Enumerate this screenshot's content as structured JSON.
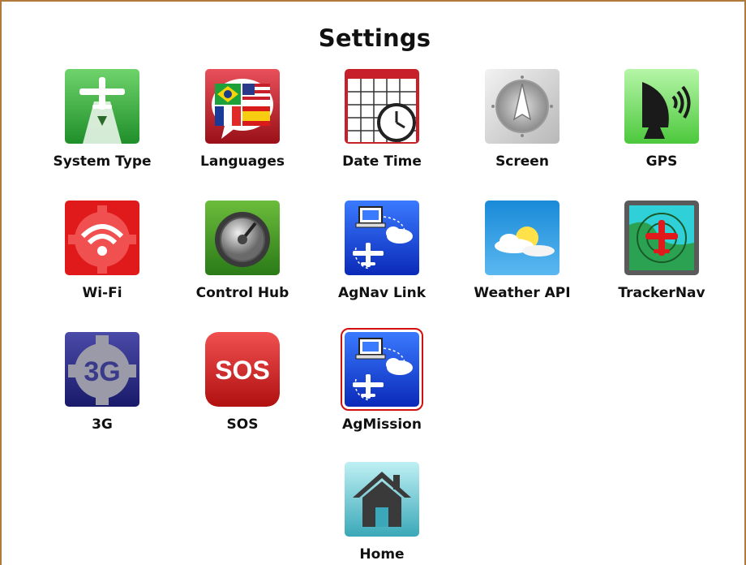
{
  "page": {
    "title": "Settings"
  },
  "tiles": [
    {
      "label": "System Type",
      "icon": "aircraft-runway-icon",
      "selected": false
    },
    {
      "label": "Languages",
      "icon": "language-flags-icon",
      "selected": false
    },
    {
      "label": "Date Time",
      "icon": "calendar-clock-icon",
      "selected": false
    },
    {
      "label": "Screen",
      "icon": "screen-compass-icon",
      "selected": false
    },
    {
      "label": "GPS",
      "icon": "gps-satellite-dish-icon",
      "selected": false
    },
    {
      "label": "Wi-Fi",
      "icon": "wifi-gear-icon",
      "selected": false
    },
    {
      "label": "Control Hub",
      "icon": "control-knob-icon",
      "selected": false
    },
    {
      "label": "AgNav Link",
      "icon": "laptop-airplane-cloud-icon",
      "selected": false
    },
    {
      "label": "Weather API",
      "icon": "weather-sun-cloud-icon",
      "selected": false
    },
    {
      "label": "TrackerNav",
      "icon": "tracker-radar-plane-icon",
      "selected": false
    },
    {
      "label": "3G",
      "icon": "3g-gear-icon",
      "icon_text": "3G",
      "selected": false
    },
    {
      "label": "SOS",
      "icon": "sos-icon",
      "icon_text": "SOS",
      "selected": false
    },
    {
      "label": "AgMission",
      "icon": "laptop-airplane-cloud-icon",
      "selected": true
    },
    {
      "label": "Home",
      "icon": "home-icon",
      "selected": false
    }
  ],
  "colors": {
    "frame_border": "#b07a3c",
    "selection_outline": "#d01010"
  }
}
